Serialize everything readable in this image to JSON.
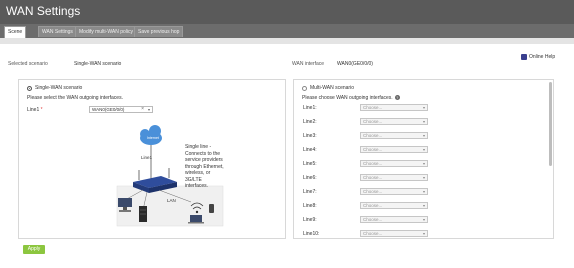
{
  "window": {
    "title": "WAN Settings"
  },
  "tabs": [
    {
      "label": "Scene",
      "active": true
    },
    {
      "label": "WAN Settings",
      "active": false
    },
    {
      "label": "Modify multi-WAN policy",
      "active": false
    },
    {
      "label": "Save previous hop",
      "active": false
    }
  ],
  "help": {
    "label": "Online Help"
  },
  "summary": {
    "scenario_label": "Selected scenario",
    "scenario_value": "Single-WAN scenario",
    "interface_label": "WAN interface",
    "interface_value": "WAN0(GE0/0/0)"
  },
  "single": {
    "title": "Single-WAN scenario",
    "selected": true,
    "hint": "Please select the WAN outgoing interfaces.",
    "line_label": "Line1",
    "required_mark": "*",
    "line_value": "WAN0(GE0/0/0)",
    "clear": "×",
    "caret": "▾",
    "diagram": {
      "cloud_label": "Internet",
      "line_label": "Line1",
      "lan_label": "LAN",
      "description": "Single line - Connects to the service providers through Ethernet, wireless, or 3G/LTE interfaces."
    }
  },
  "multi": {
    "title": "Multi-WAN scenario",
    "selected": false,
    "hint": "Please choose WAN outgoing interfaces.",
    "help_icon": "?",
    "caret": "▾",
    "lines": [
      {
        "label": "Line1:",
        "value": "Choose..."
      },
      {
        "label": "Line2:",
        "value": "Choose..."
      },
      {
        "label": "Line3:",
        "value": "Choose..."
      },
      {
        "label": "Line4:",
        "value": "Choose..."
      },
      {
        "label": "Line5:",
        "value": "Choose..."
      },
      {
        "label": "Line6:",
        "value": "Choose..."
      },
      {
        "label": "Line7:",
        "value": "Choose..."
      },
      {
        "label": "Line8:",
        "value": "Choose..."
      },
      {
        "label": "Line9:",
        "value": "Choose..."
      },
      {
        "label": "Line10:",
        "value": "Choose..."
      }
    ]
  },
  "apply": {
    "label": "Apply"
  },
  "colors": {
    "titlebar": "#5a5a5a",
    "apply": "#8cc63f",
    "router": "#2f4d9c",
    "cloud": "#4a90d9"
  }
}
